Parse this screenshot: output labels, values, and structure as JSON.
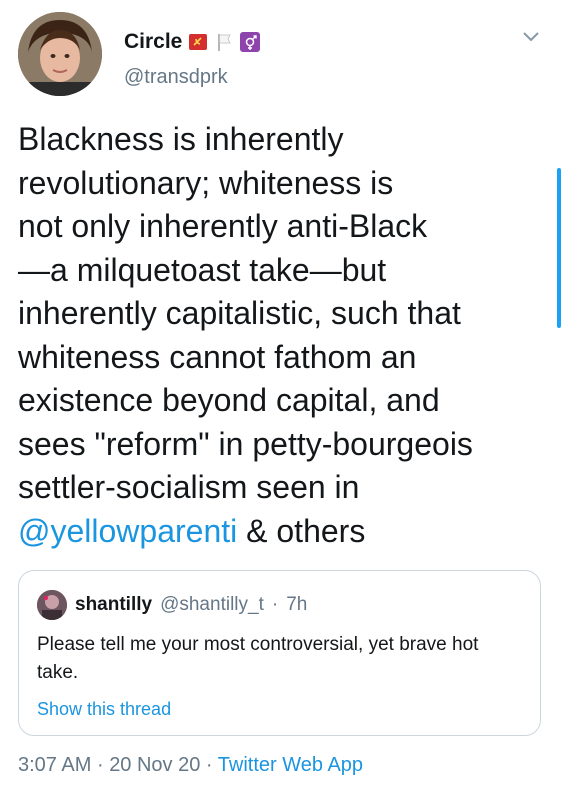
{
  "author": {
    "name": "Circle",
    "handle": "@transdprk",
    "badges": [
      "hammer-sickle-flag-icon",
      "white-flag-icon",
      "transgender-symbol-icon"
    ]
  },
  "tweet": {
    "text": "Blackness is inherently\nrevolutionary; whiteness is\nnot only inherently anti-Black\n—a milquetoast take—but\ninherently capitalistic, such that\nwhiteness cannot fathom an\nexistence beyond capital, and\nsees \"reform\" in petty-bourgeois\nsettler-socialism seen in\n",
    "mention": "@yellowparenti",
    "text_after_mention": " & others"
  },
  "quoted": {
    "name": "shantilly",
    "handle": "@shantilly_t",
    "separator": "·",
    "time": "7h",
    "text": "Please tell me your most controversial, yet brave hot take.",
    "thread_link": "Show this thread"
  },
  "footer": {
    "time": "3:07 AM",
    "date": "20 Nov 20",
    "separator": "·",
    "source": "Twitter Web App"
  },
  "colors": {
    "link": "#1b95e0",
    "muted": "#657786",
    "text": "#14171a",
    "border": "#ccd6dd"
  }
}
